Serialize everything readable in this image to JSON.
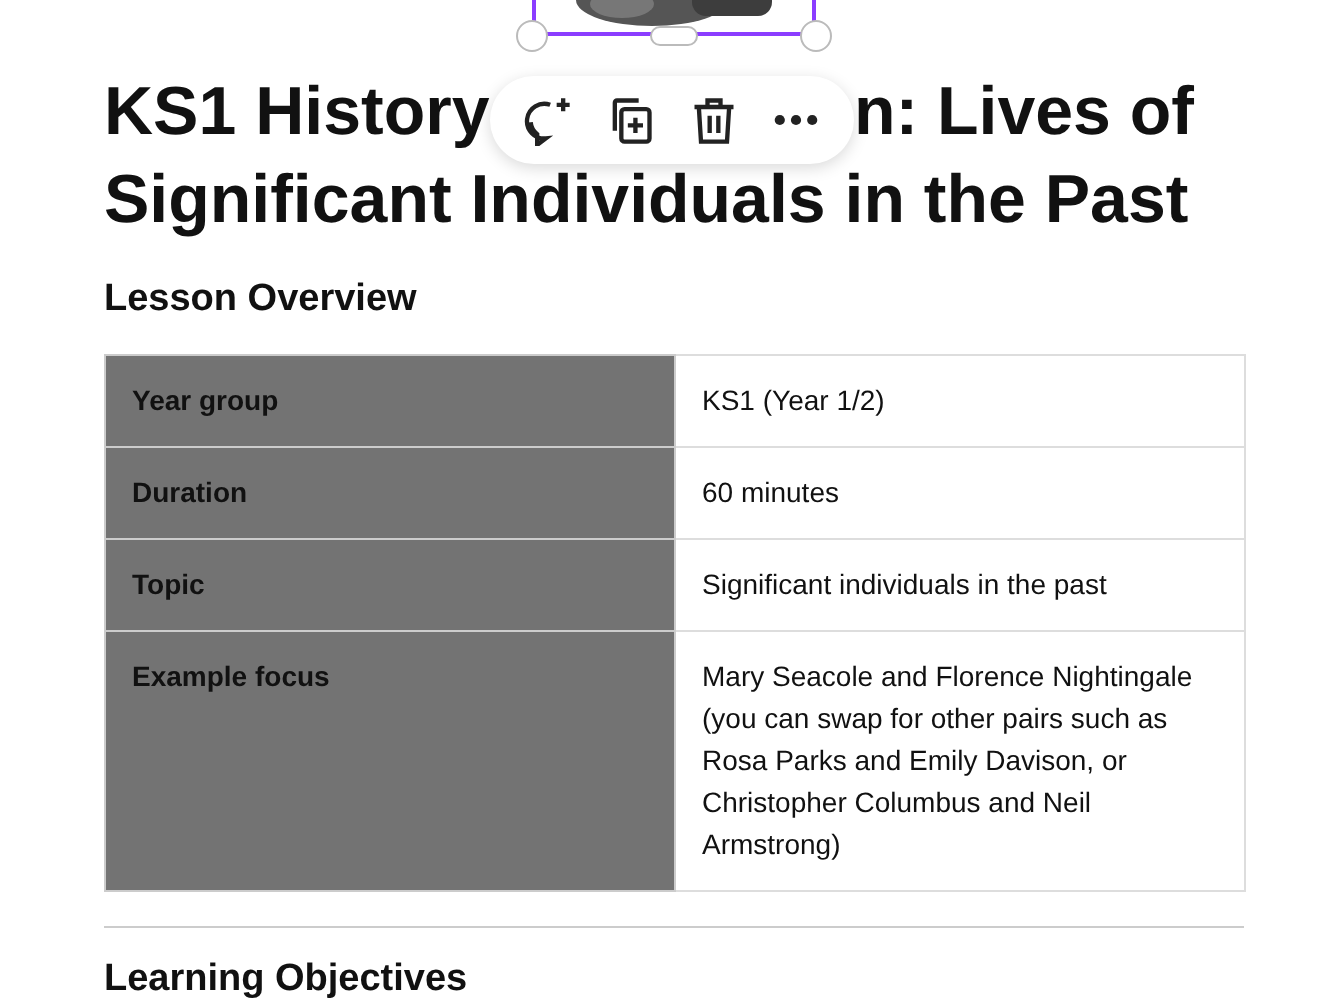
{
  "selected_element": {
    "kind": "picture",
    "toolbar": {
      "buttons": [
        {
          "kind": "comment"
        },
        {
          "kind": "duplicate"
        },
        {
          "kind": "delete"
        },
        {
          "kind": "more"
        }
      ]
    }
  },
  "heading": {
    "line_1_parts": [
      "KS1 History",
      "n: Lives of"
    ],
    "line_2": "Significant Individuals in the Past"
  },
  "section_title": "Lesson Overview",
  "table": {
    "rows": [
      {
        "label": "Year group",
        "value": "KS1 (Year 1/2)"
      },
      {
        "label": "Duration",
        "value": "60 minutes"
      },
      {
        "label": "Topic",
        "value": "Significant individuals in the past"
      },
      {
        "label": "Example focus",
        "value": "Mary Seacole and Florence Nightingale (you can swap for other pairs such as Rosa Parks and Emily Davison, or Christopher Columbus and Neil Armstrong)"
      }
    ]
  },
  "next_section_title": "Learning Objectives"
}
